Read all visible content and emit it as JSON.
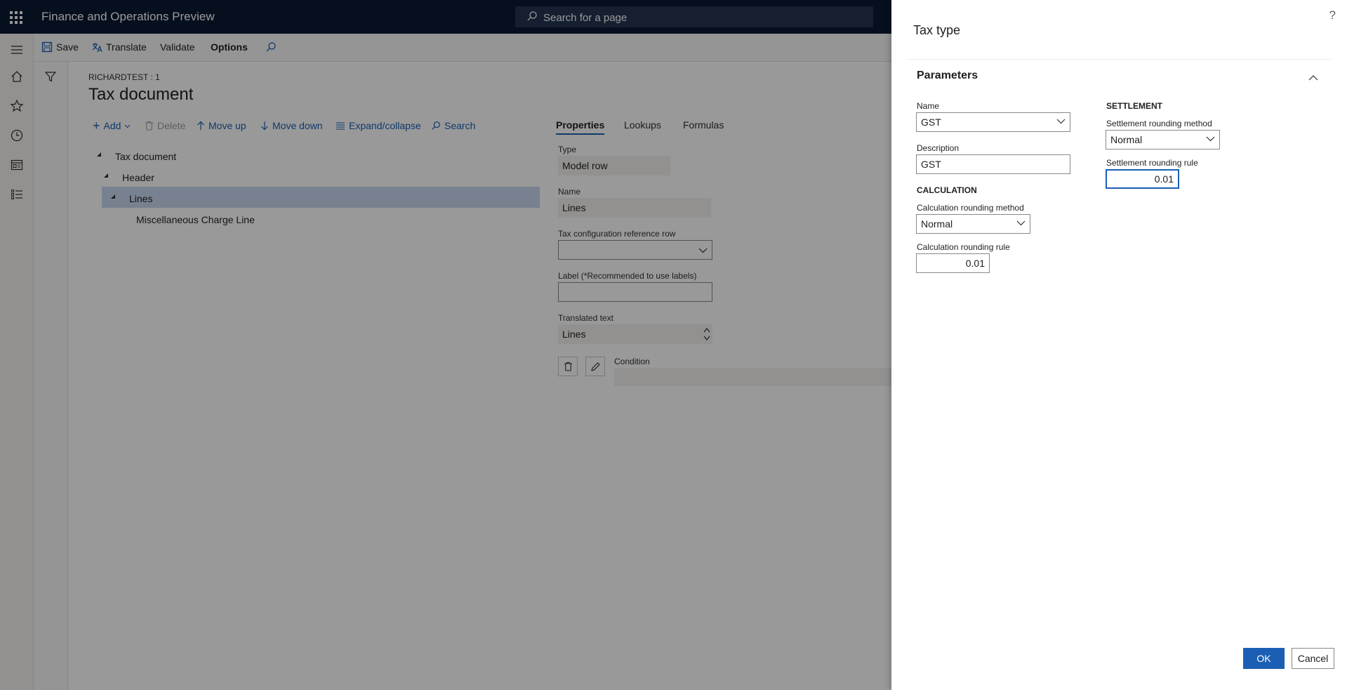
{
  "app": {
    "title": "Finance and Operations Preview",
    "search_placeholder": "Search for a page"
  },
  "action_pane": {
    "save": "Save",
    "translate": "Translate",
    "validate": "Validate",
    "options": "Options"
  },
  "page": {
    "breadcrumb": "RICHARDTEST : 1",
    "title": "Tax document",
    "toolbar": {
      "add": "Add",
      "delete": "Delete",
      "move_up": "Move up",
      "move_down": "Move down",
      "expand_collapse": "Expand/collapse",
      "search": "Search"
    },
    "tree": [
      {
        "label": "Tax document"
      },
      {
        "label": "Header"
      },
      {
        "label": "Lines",
        "selected": true
      },
      {
        "label": "Miscellaneous Charge Line"
      }
    ],
    "tabs": [
      "Properties",
      "Lookups",
      "Formulas"
    ],
    "properties": {
      "type_label": "Type",
      "type_value": "Model row",
      "name_label": "Name",
      "name_value": "Lines",
      "ref_row_label": "Tax configuration reference row",
      "ref_row_value": "",
      "label_label": "Label (*Recommended to use labels)",
      "label_value": "",
      "translated_label": "Translated text",
      "translated_value": "Lines",
      "condition_label": "Condition"
    }
  },
  "dialog": {
    "title": "Tax type",
    "help": "?",
    "fasttab": "Parameters",
    "name_label": "Name",
    "name_value": "GST",
    "description_label": "Description",
    "description_value": "GST",
    "calculation_group": "CALCULATION",
    "calc_method_label": "Calculation rounding method",
    "calc_method_value": "Normal",
    "calc_rule_label": "Calculation rounding rule",
    "calc_rule_value": "0.01",
    "settlement_group": "SETTLEMENT",
    "settle_method_label": "Settlement rounding method",
    "settle_method_value": "Normal",
    "settle_rule_label": "Settlement rounding rule",
    "settle_rule_value": "0.01",
    "ok": "OK",
    "cancel": "Cancel"
  },
  "colors": {
    "nav_dark": "#0b1a33",
    "accent": "#1a5fb4",
    "selection": "#c9d8f0"
  }
}
